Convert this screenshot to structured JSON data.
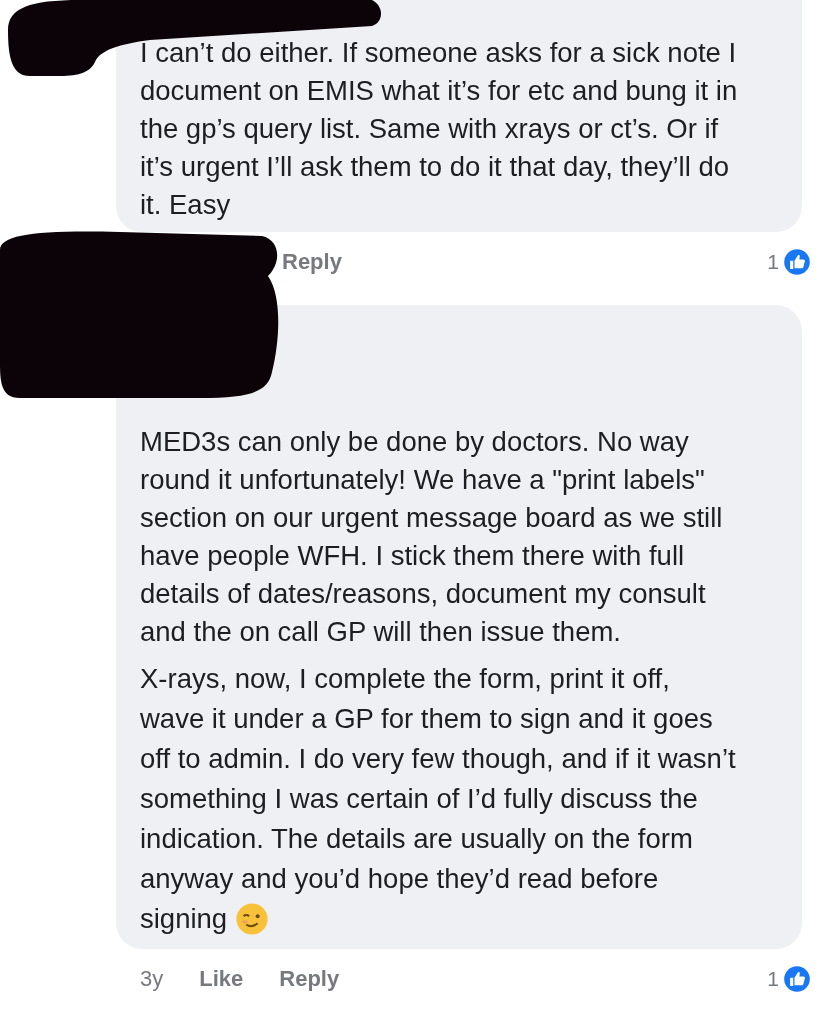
{
  "comments": [
    {
      "author_redacted": true,
      "paragraphs": [
        "I can’t do either. If someone asks for a sick note I\ndocument on EMIS what it’s for etc and bung it in\nthe gp’s query list. Same with xrays or ct’s. Or if\nit’s urgent I’ll ask them to do it that day, they’ll do\nit. Easy"
      ],
      "emoji": false,
      "actions": [
        {
          "kind": "reply",
          "label": "Reply"
        }
      ],
      "reactions": "1"
    },
    {
      "author_redacted": true,
      "paragraphs": [
        "MED3s can only be done by doctors. No way\nround it unfortunately! We have a \"print labels\"\nsection on our urgent message board as we still\nhave people WFH. I stick them there with full\ndetails of dates/reasons, document my consult\nand the on call GP will then issue them.",
        "X-rays, now, I complete the form, print it off,\nwave it under a GP for them to sign and it goes\noff to admin. I do very few though, and if it wasn’t\nsomething I was certain of I’d fully discuss the\nindication. The details are usually on the form\nanyway and you’d hope they’d read before\nsigning"
      ],
      "emoji": true,
      "actions": [
        {
          "kind": "time",
          "label": "3y"
        },
        {
          "kind": "like",
          "label": "Like"
        },
        {
          "kind": "reply",
          "label": "Reply"
        }
      ],
      "reactions": "1"
    }
  ]
}
